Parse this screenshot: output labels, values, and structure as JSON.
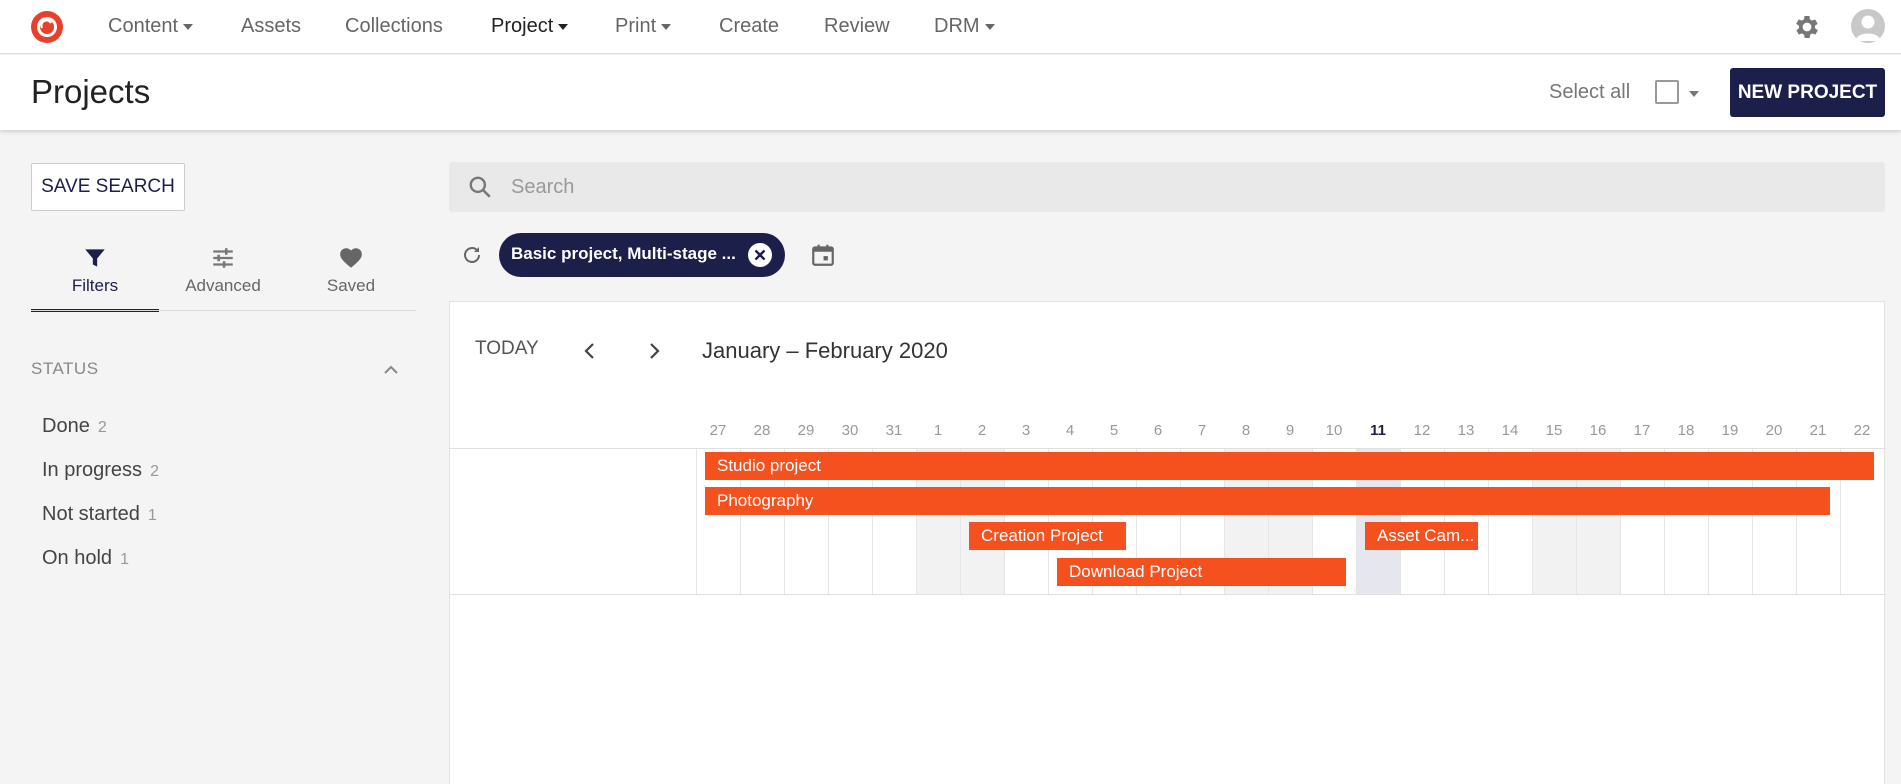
{
  "nav": {
    "items": [
      {
        "label": "Content",
        "has_caret": true,
        "active": false
      },
      {
        "label": "Assets",
        "has_caret": false,
        "active": false
      },
      {
        "label": "Collections",
        "has_caret": false,
        "active": false
      },
      {
        "label": "Project",
        "has_caret": true,
        "active": true
      },
      {
        "label": "Print",
        "has_caret": true,
        "active": false
      },
      {
        "label": "Create",
        "has_caret": false,
        "active": false
      },
      {
        "label": "Review",
        "has_caret": false,
        "active": false
      },
      {
        "label": "DRM",
        "has_caret": true,
        "active": false
      }
    ],
    "icons": {
      "logo": "app-logo",
      "settings": "gear-icon",
      "avatar": "user-avatar"
    }
  },
  "header": {
    "title": "Projects",
    "select_all_label": "Select all",
    "new_project_label": "NEW PROJECT"
  },
  "sidebar": {
    "save_search_label": "SAVE SEARCH",
    "tabs": [
      {
        "label": "Filters",
        "icon": "filter-icon",
        "active": true
      },
      {
        "label": "Advanced",
        "icon": "sliders-icon",
        "active": false
      },
      {
        "label": "Saved",
        "icon": "heart-icon",
        "active": false
      }
    ],
    "status_heading": "STATUS",
    "statuses": [
      {
        "label": "Done",
        "count": "2"
      },
      {
        "label": "In progress",
        "count": "2"
      },
      {
        "label": "Not started",
        "count": "1"
      },
      {
        "label": "On hold",
        "count": "1"
      }
    ]
  },
  "search": {
    "placeholder": "Search",
    "value": ""
  },
  "filter_chip": {
    "label": "Basic project, Multi-stage ..."
  },
  "timeline": {
    "today_label": "TODAY",
    "range_title": "January – February 2020",
    "days": [
      "27",
      "28",
      "29",
      "30",
      "31",
      "1",
      "2",
      "3",
      "4",
      "5",
      "6",
      "7",
      "8",
      "9",
      "10",
      "11",
      "12",
      "13",
      "14",
      "15",
      "16",
      "17",
      "18",
      "19",
      "20",
      "21",
      "22"
    ],
    "today_day": "11",
    "weekend_days": [
      "1",
      "2",
      "8",
      "9",
      "15",
      "16"
    ],
    "projects": [
      {
        "name": "Studio project",
        "start_day": "27",
        "end_day": "22",
        "row": 1
      },
      {
        "name": "Photography",
        "start_day": "27",
        "end_day": "21",
        "row": 2
      },
      {
        "name": "Creation Project",
        "start_day": "2",
        "end_day": "5",
        "row": 3
      },
      {
        "name": "Asset Cam...",
        "start_day": "11",
        "end_day": "13",
        "row": 3
      },
      {
        "name": "Download Project",
        "start_day": "4",
        "end_day": "10",
        "row": 4
      }
    ],
    "bar_color": "#f4511e"
  },
  "colors": {
    "brand_navy": "#1c1f4a",
    "bar_orange": "#f4511e",
    "logo_red": "#e8402a"
  }
}
